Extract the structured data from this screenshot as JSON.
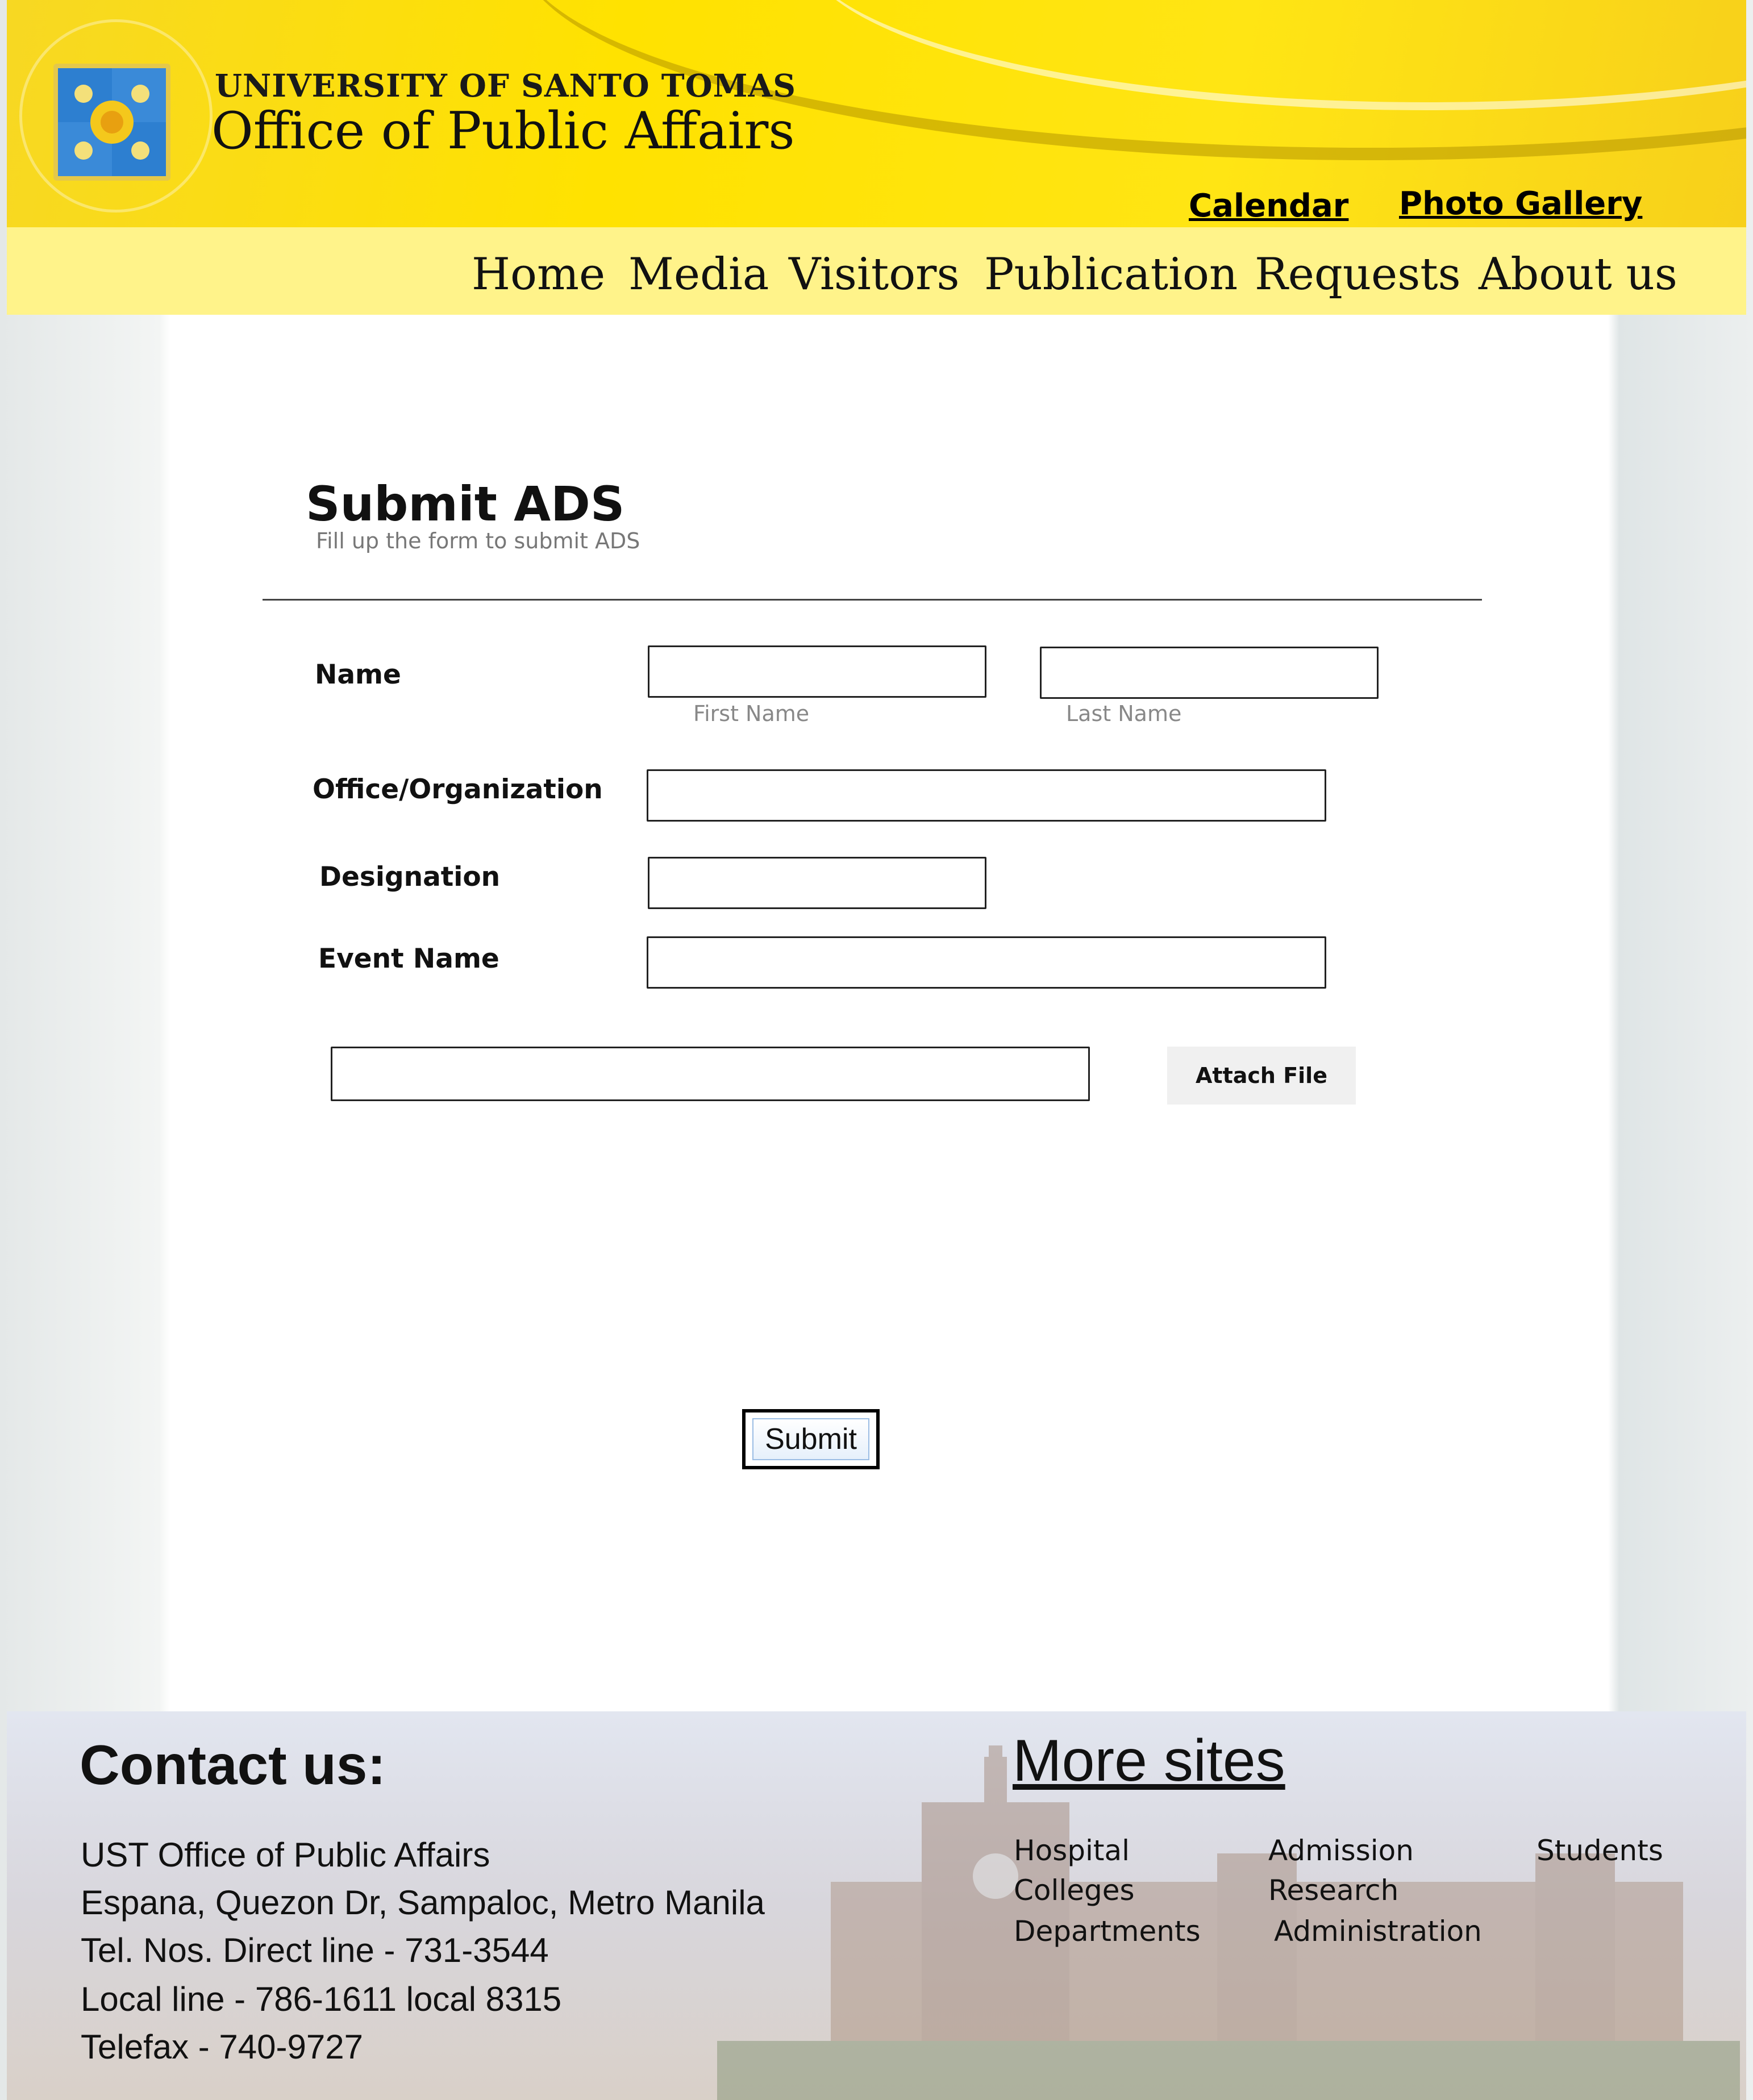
{
  "header": {
    "university": "UNIVERSITY OF SANTO TOMAS",
    "office": "Office of Public Affairs",
    "top_links": [
      "Calendar",
      "Photo Gallery"
    ],
    "colors": {
      "header_yellow": "#ffe200",
      "nav_yellow": "#fff38a",
      "seal_blue": "#2d7fd0"
    },
    "logo_icon": "ust-seal-icon"
  },
  "nav": [
    "Home",
    "Media",
    "Visitors",
    "Publication",
    "Requests",
    "About us"
  ],
  "form": {
    "title": "Submit ADS",
    "subtitle": "Fill up the form to submit ADS",
    "name_label": "Name",
    "first_name_hint": "First Name",
    "last_name_hint": "Last Name",
    "office_label": "Office/Organization",
    "designation_label": "Designation",
    "event_label": "Event Name",
    "first_name_value": "",
    "last_name_value": "",
    "office_value": "",
    "designation_value": "",
    "event_value": "",
    "file_value": "",
    "attach_label": "Attach File",
    "submit_label": "Submit"
  },
  "footer": {
    "contact_title": "Contact us:",
    "contact_lines": [
      "UST Office of Public Affairs",
      "Espana, Quezon Dr, Sampaloc, Metro Manila",
      "Tel. Nos. Direct line - 731-3544",
      "Local line - 786-1611 local 8315",
      "Telefax - 740-9727"
    ],
    "more_title": "More sites",
    "sites": [
      "Hospital",
      "Colleges",
      "Departments",
      "Admission",
      "Research",
      "Administration",
      "Students"
    ]
  }
}
